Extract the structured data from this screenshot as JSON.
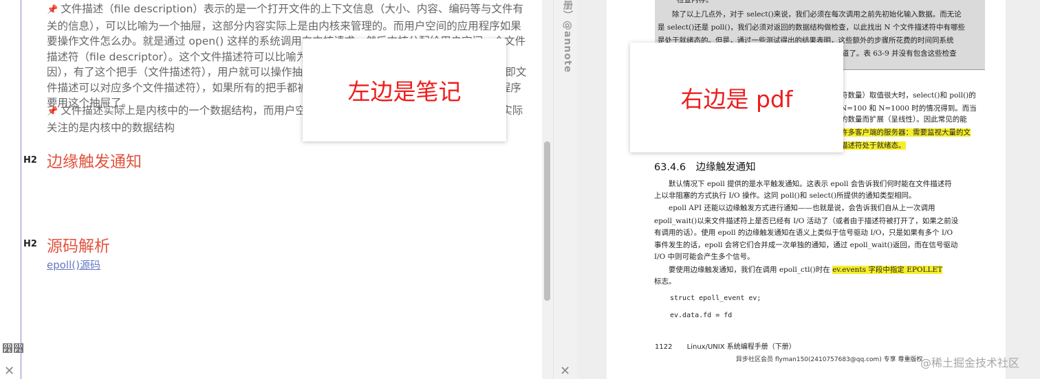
{
  "notes": {
    "paragraph1_prefix_icon": "📌",
    "paragraph1": "文件描述（file description）表示的是一个打开文件的上下文信息（大小、内容、编码等与文件有关的信息），可以比喻为一个抽屉，这部分内容实际上是由内核来管理的。而用户空间的应用程序如果要操作文件怎么办。就是通过 open() 这样的系统调用向内核请求，然后内核分配给用户空间一个文件描述符（file descriptor）。这个文件描述符可以比喻为抽屉的把手（这也是我们称 fd 为句柄的原因），有了这个把手（文件描述符），用户就可以操作抽屉里的东西了。一个抽屉可以有多个把手（即文件描述可以对应多个文件描述符），如果所有的把手都被关闭了，内核就知道此时没有用户空间的程序要用这个抽屉了。",
    "paragraph2_prefix_icon": "📌",
    "paragraph2": "文件描述实际上是内核中的一个数据结构，而用户空间的 fd 只是一个整数，epoll 的兴趣列表实际关注的是内核中的数据结构",
    "h2_badge": "H2",
    "heading_edge": "边缘触发通知",
    "heading_source": "源码解析",
    "link_epoll_source": "epoll()源码",
    "overlay_left": "左边是笔记"
  },
  "icons": {
    "glasses": "glasses-icon",
    "close": "close-icon"
  },
  "strip": {
    "vertical_text": "册）@annote"
  },
  "pdf": {
    "gray_line0": "检查内存。",
    "gray_line1": "　　除了以上几点外，对于 select()来说，我们必须在每次调用之前先初始化输入数据。而无论",
    "gray_line2": "是 select()还是 poll()，我们必须对返回的数据结构做检查，以此找出 N 个文件描述符中有哪些",
    "gray_line3": "是处于就绪态的。但是，通过一些测试得出的结果表明，这些额外的步骤所花费的时间同系统",
    "gray_line4": "调用监视 N 个文件描述符所花费的时间相比就显得微不足道了。表 63-9 并没有包含这些检查",
    "p2_line1": "符数量）取值很大时，select()和 poll()的",
    "p2_line2": "N=100 和 N=1000 时的情况得到。而当",
    "p3_line1": "的数量而扩展（呈线性）。因此常见的能",
    "p3_line2_hl": "许多客户端的服务器：需要监视大量的文",
    "p3_line3_hl": "描述符处于就绪态。",
    "section_heading": "63.4.6　边缘触发通知",
    "b1": "　　默认情况下 epoll 提供的是水平触发通知。这表示 epoll 会告诉我们何时能在文件描述符",
    "b2": "上以非阻塞的方式执行 I/O 操作。这同 poll()和 select()所提供的通知类型相同。",
    "b3": "　　epoll API 还能以边缘触发方式进行通知——也就是说，会告诉我们自从上一次调用",
    "b4": "epoll_wait()以来文件描述符上是否已经有 I/O 活动了（或者由于描述符被打开了，如果之前没",
    "b5": "有调用的话）。使用 epoll 的边缘触发通知在语义上类似于信号驱动 I/O，只是如果有多个 I/O",
    "b6": "事件发生的话，epoll 会将它们合并成一次单独的通知，通过 epoll_wait()返回，而在信号驱动",
    "b7": "I/O 中则可能会产生多个信号。",
    "b8_pre": "　　要使用边缘触发通知，我们在调用 epoll_ctl()时在 ",
    "b8_hl": "ev.events 字段中指定 EPOLLET",
    "b9": "标志。",
    "code1": "struct epoll_event ev;",
    "code2": "ev.data.fd = fd",
    "footer_page": "1122",
    "footer_title": "Linux/UNIX 系统编程手册（下册）",
    "footer_member": "异步社区会员 flyman150(2410757683@qq.com) 专享 尊重版权",
    "overlay_right": "右边是 pdf"
  },
  "watermark": "@稀土掘金技术社区",
  "colors": {
    "heading_red": "#e2533e",
    "overlay_red": "#ee1d1d",
    "link_blue": "#6477c6",
    "highlight_yellow": "#f7ee2a",
    "gutter_purple": "#8f84c9"
  }
}
